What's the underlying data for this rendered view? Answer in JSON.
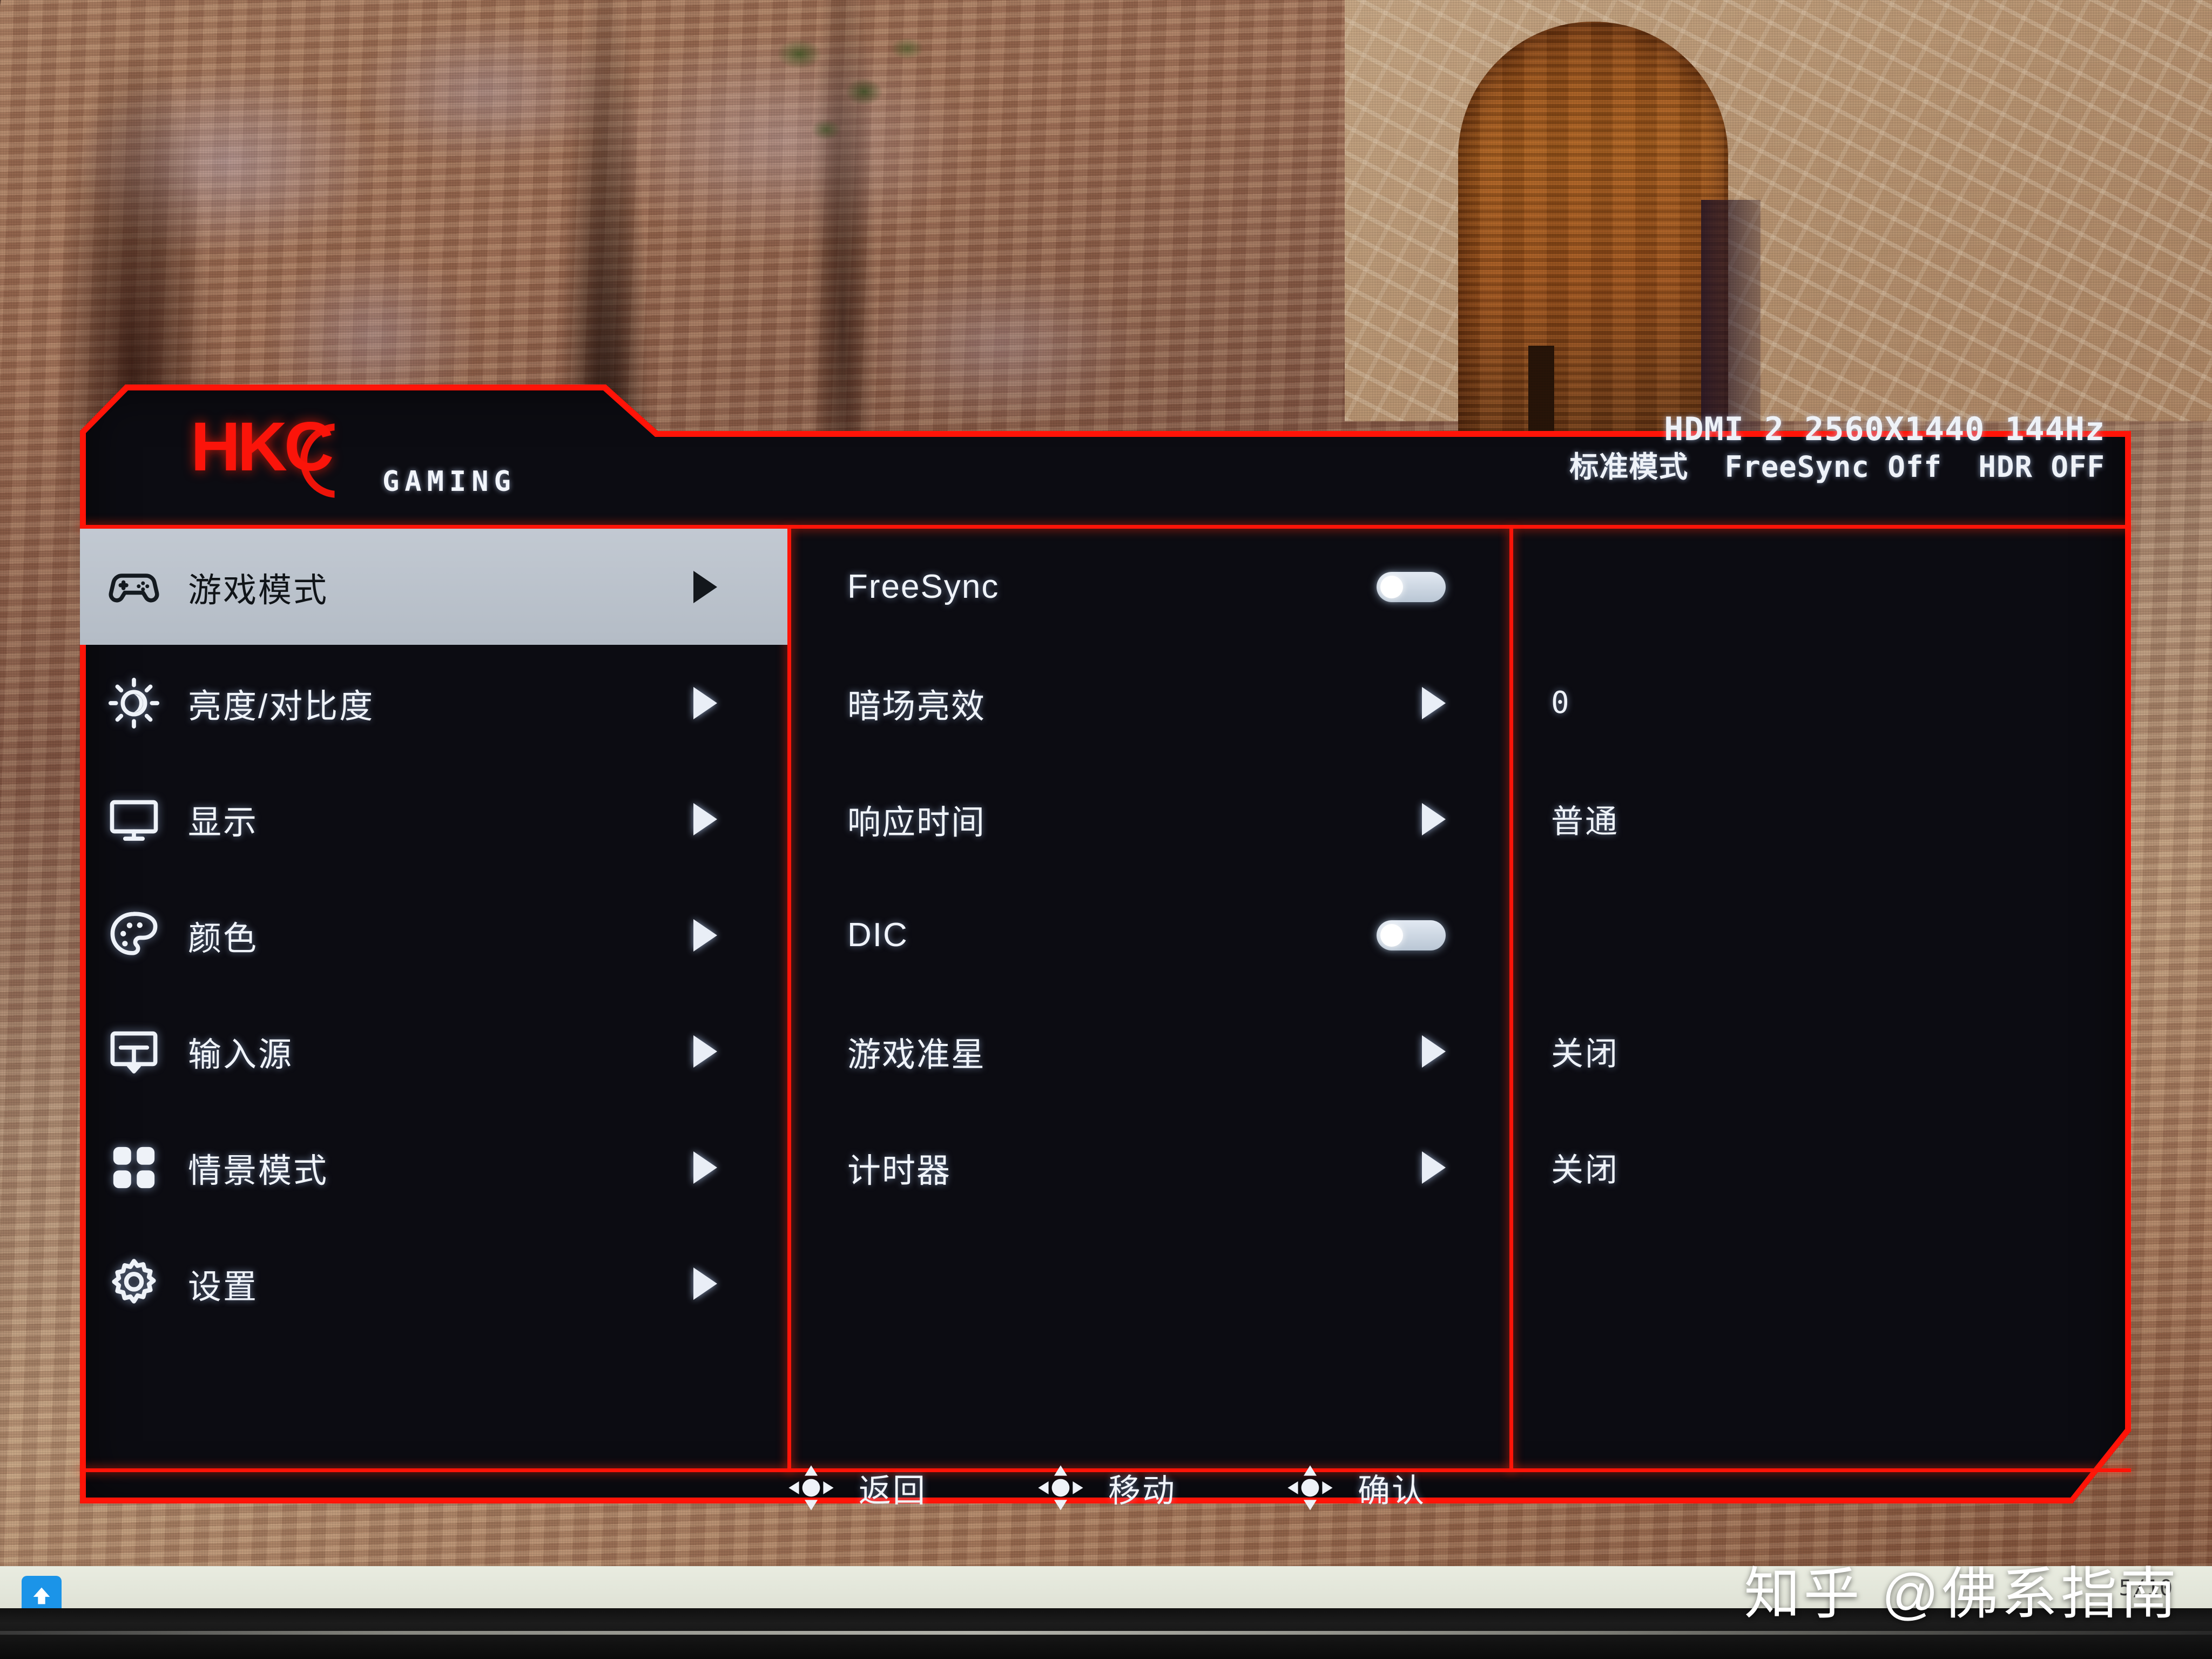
{
  "brand": {
    "logo_text": "HKC",
    "sub_text": "GAMING"
  },
  "signal_info": {
    "line1": "HDMI 2 2560X1440 144Hz",
    "preset_mode": "标准模式",
    "freesync": "FreeSync Off",
    "hdr": "HDR OFF"
  },
  "sidebar": {
    "items": [
      {
        "label": "游戏模式",
        "icon": "gamepad-icon",
        "selected": true,
        "arrow": "▶"
      },
      {
        "label": "亮度/对比度",
        "icon": "brightness-icon",
        "selected": false,
        "arrow": "▶"
      },
      {
        "label": "显示",
        "icon": "monitor-icon",
        "selected": false,
        "arrow": "▶"
      },
      {
        "label": "颜色",
        "icon": "palette-icon",
        "selected": false,
        "arrow": "▶"
      },
      {
        "label": "输入源",
        "icon": "input-source-icon",
        "selected": false,
        "arrow": "▶"
      },
      {
        "label": "情景模式",
        "icon": "grid-tiles-icon",
        "selected": false,
        "arrow": "▶"
      },
      {
        "label": "设置",
        "icon": "gear-icon",
        "selected": false,
        "arrow": "▶"
      }
    ]
  },
  "options": {
    "items": [
      {
        "label": "FreeSync",
        "control": "toggle",
        "toggle_state": "off",
        "value": ""
      },
      {
        "label": "暗场亮效",
        "control": "arrow",
        "value": "0"
      },
      {
        "label": "响应时间",
        "control": "arrow",
        "value": "普通"
      },
      {
        "label": "DIC",
        "control": "toggle",
        "toggle_state": "off",
        "value": ""
      },
      {
        "label": "游戏准星",
        "control": "arrow",
        "value": "关闭"
      },
      {
        "label": "计时器",
        "control": "arrow",
        "value": "关闭"
      }
    ]
  },
  "footer": {
    "buttons": [
      {
        "label": "返回",
        "icon": "dpad-icon"
      },
      {
        "label": "移动",
        "icon": "dpad-icon"
      },
      {
        "label": "确认",
        "icon": "dpad-icon"
      }
    ]
  },
  "overlay": {
    "watermark": "知乎 @佛系指南",
    "datestamp": "5/10"
  },
  "taskbar": {
    "icon": "arrow-up-app-icon"
  },
  "colors": {
    "osd_border_red": "#ff1408",
    "osd_background": "#0c0c12",
    "selected_row": "#bcc4ce",
    "text_white": "#f0f4fa",
    "logo_red": "#fb140a",
    "taskbar_icon_blue": "#1b94e8"
  }
}
